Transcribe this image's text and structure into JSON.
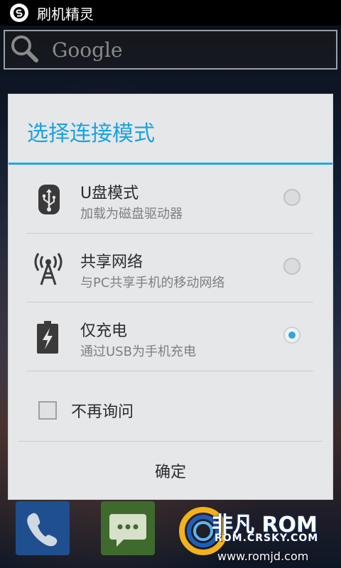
{
  "status_bar": {
    "app_name": "刷机精灵"
  },
  "search": {
    "placeholder": "Google"
  },
  "dialog": {
    "title": "选择连接模式",
    "options": [
      {
        "icon": "usb-icon",
        "title": "U盘模式",
        "subtitle": "加载为磁盘驱动器",
        "selected": false
      },
      {
        "icon": "network-tower-icon",
        "title": "共享网络",
        "subtitle": "与PC共享手机的移动网络",
        "selected": false
      },
      {
        "icon": "battery-charging-icon",
        "title": "仅充电",
        "subtitle": "通过USB为手机充电",
        "selected": true
      }
    ],
    "checkbox_label": "不再询问",
    "checkbox_checked": false,
    "ok_label": "确定"
  },
  "dock": [
    {
      "icon": "phone-icon"
    },
    {
      "icon": "message-icon"
    }
  ],
  "watermark": {
    "brand": "非凡 ROM",
    "domain": "ROM.CRSKY.COM",
    "url": "www.romjd.com"
  }
}
